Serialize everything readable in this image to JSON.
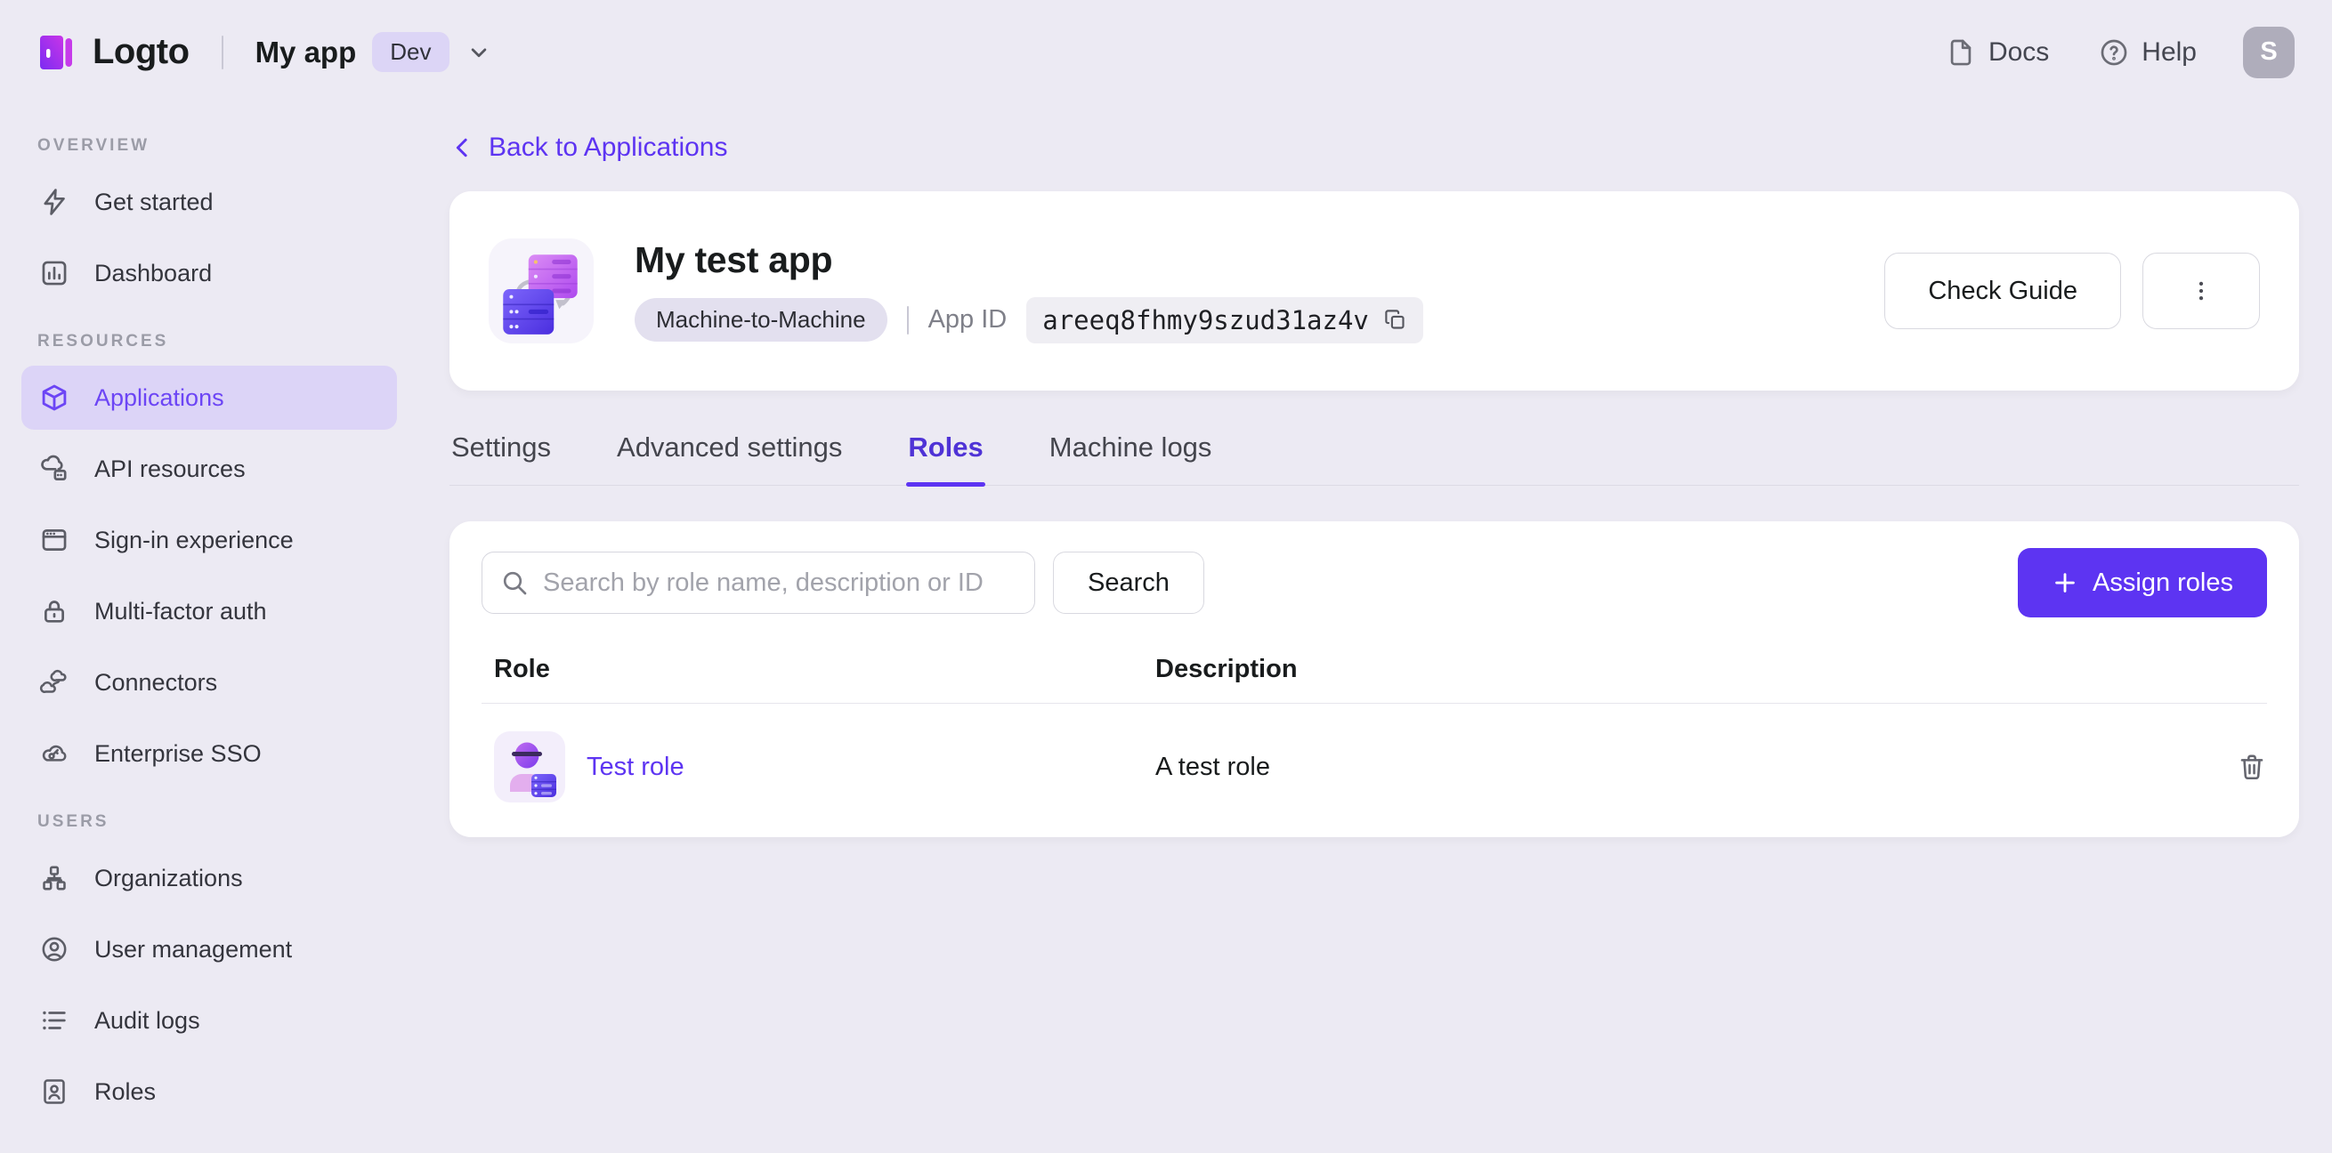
{
  "colors": {
    "accent": "#5D34F2",
    "sidebar_active_bg": "#DCD4F7",
    "page_bg": "#ECEAF3",
    "card_bg": "#FFFFFF",
    "env_badge_bg": "#DCD5F6",
    "avatar_bg": "#AFADBB"
  },
  "topbar": {
    "brand": "Logto",
    "app_name": "My app",
    "env_badge": "Dev",
    "docs": "Docs",
    "help": "Help",
    "avatar_initial": "S"
  },
  "sidebar": {
    "sections": [
      {
        "title": "OVERVIEW",
        "items": [
          {
            "label": "Get started"
          },
          {
            "label": "Dashboard"
          }
        ]
      },
      {
        "title": "RESOURCES",
        "items": [
          {
            "label": "Applications",
            "active": true
          },
          {
            "label": "API resources"
          },
          {
            "label": "Sign-in experience"
          },
          {
            "label": "Multi-factor auth"
          },
          {
            "label": "Connectors"
          },
          {
            "label": "Enterprise SSO"
          }
        ]
      },
      {
        "title": "USERS",
        "items": [
          {
            "label": "Organizations"
          },
          {
            "label": "User management"
          },
          {
            "label": "Audit logs"
          },
          {
            "label": "Roles"
          }
        ]
      }
    ]
  },
  "main": {
    "back_link": "Back to Applications",
    "app_header": {
      "title": "My test app",
      "type_badge": "Machine-to-Machine",
      "app_id_label": "App ID",
      "app_id_value": "areeq8fhmy9szud31az4v",
      "check_guide": "Check Guide"
    },
    "tabs": [
      {
        "label": "Settings"
      },
      {
        "label": "Advanced settings"
      },
      {
        "label": "Roles",
        "active": true
      },
      {
        "label": "Machine logs"
      }
    ],
    "roles_panel": {
      "search_placeholder": "Search by role name, description or ID",
      "search_button": "Search",
      "assign_button": "Assign roles",
      "table": {
        "columns": [
          "Role",
          "Description"
        ],
        "rows": [
          {
            "role": "Test role",
            "description": "A test role"
          }
        ]
      }
    }
  }
}
